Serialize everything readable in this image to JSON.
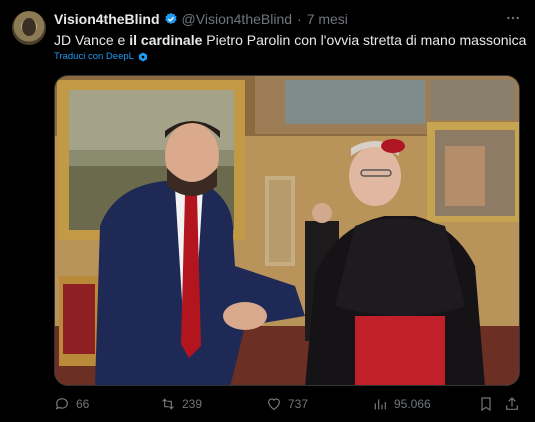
{
  "author": {
    "name": "Vision4theBlind",
    "handle": "@Vision4theBlind",
    "separator": "·",
    "time": "7 mesi"
  },
  "tweet": {
    "text_part1": "JD Vance e ",
    "text_bold": "il cardinale",
    "text_part2": " Pietro Parolin con l'ovvia stretta di mano massonica",
    "translate_label": "Traduci con DeepL"
  },
  "actions": {
    "replies": "66",
    "reposts": "239",
    "likes": "737",
    "views": "95.066"
  },
  "icons": {
    "verified": "verified-badge-icon",
    "more": "more-icon",
    "deepl": "deepl-icon",
    "reply": "reply-icon",
    "repost": "repost-icon",
    "like": "like-icon",
    "views": "views-icon",
    "bookmark": "bookmark-icon",
    "share": "share-icon"
  },
  "colors": {
    "accent": "#1d9bf0",
    "muted": "#71767b",
    "text": "#e7e9ea",
    "background": "#000000"
  }
}
